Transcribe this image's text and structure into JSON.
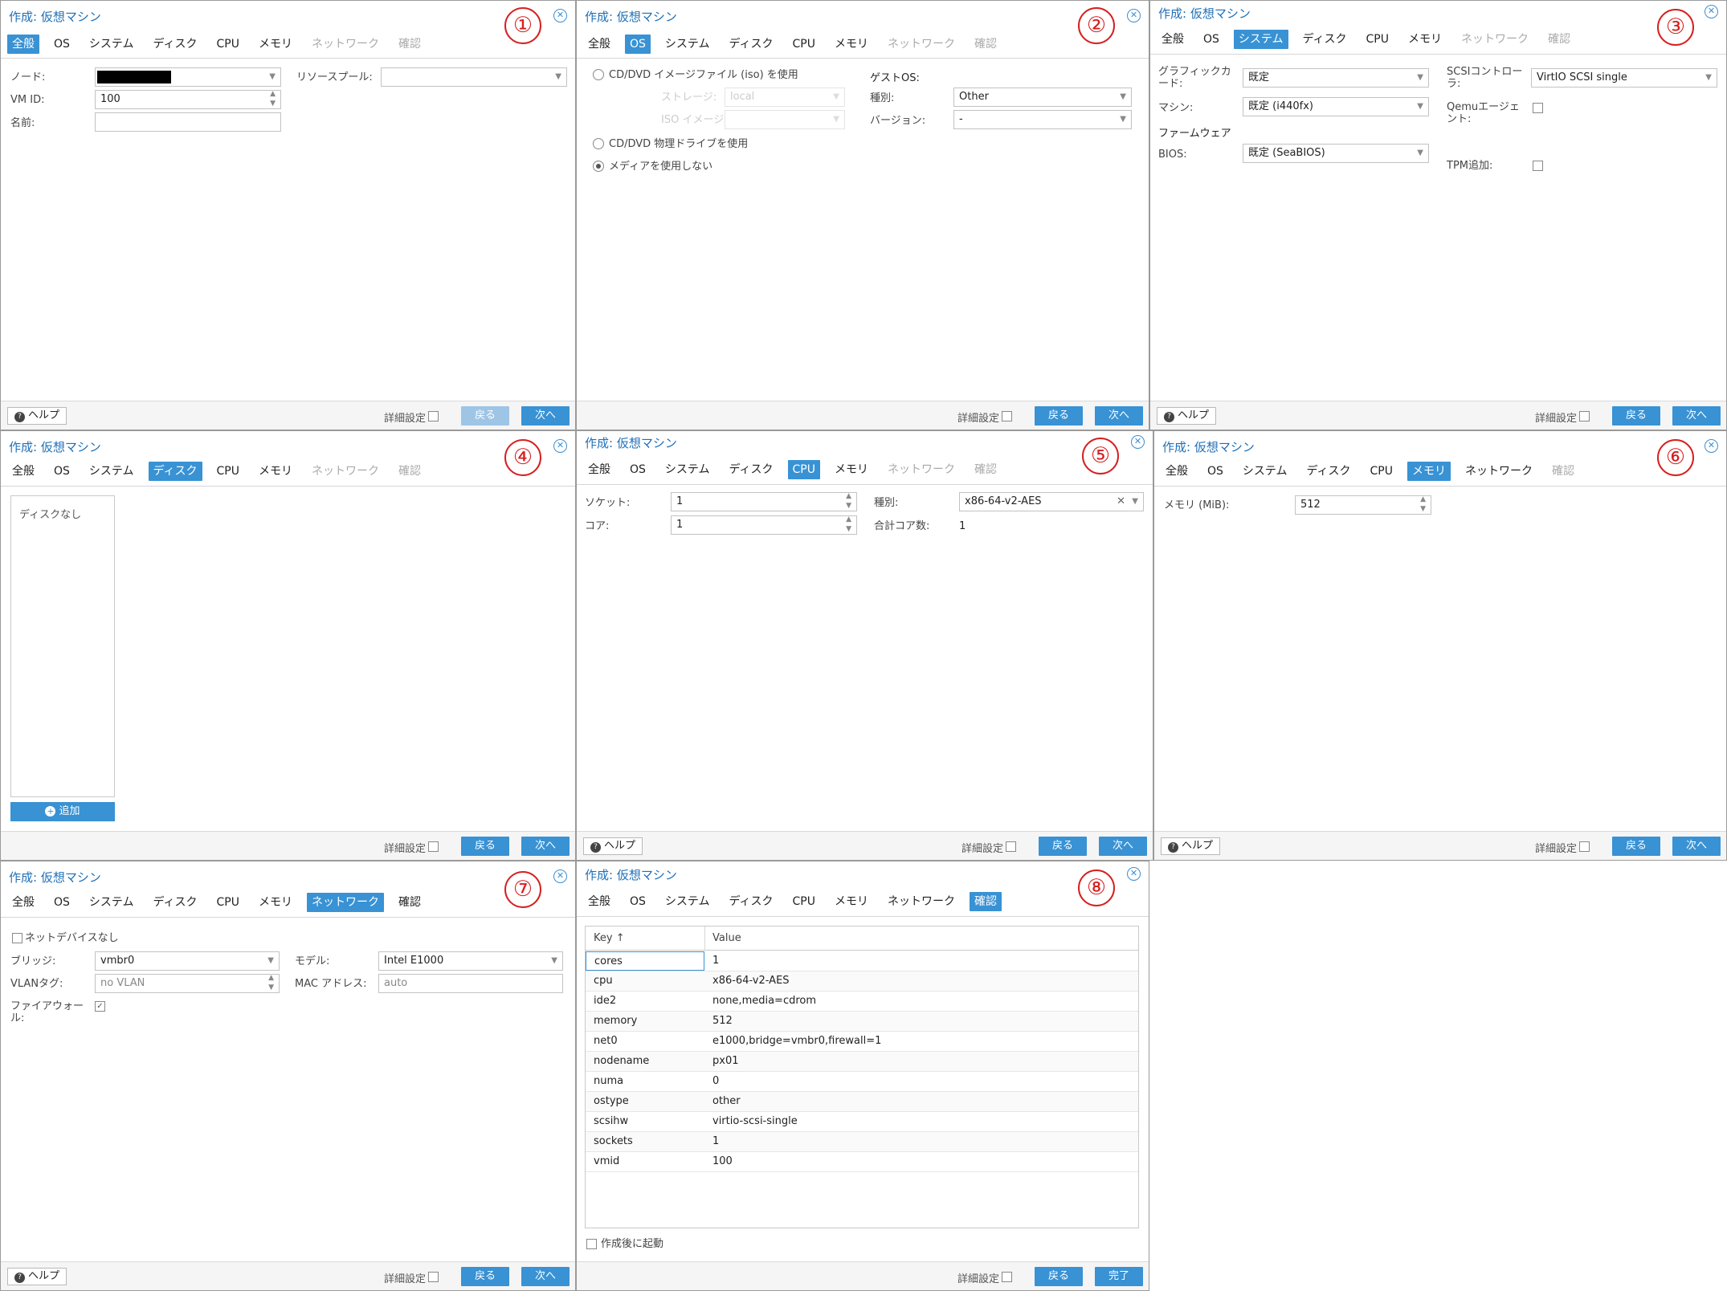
{
  "title": "作成: 仮想マシン",
  "tabs": {
    "general": "全般",
    "os": "OS",
    "system": "システム",
    "disk": "ディスク",
    "cpu": "CPU",
    "memory": "メモリ",
    "network": "ネットワーク",
    "confirm": "確認"
  },
  "footer": {
    "help": "ヘルプ",
    "advanced": "詳細設定",
    "back": "戻る",
    "next": "次へ",
    "finish": "完了"
  },
  "markers": [
    "①",
    "②",
    "③",
    "④",
    "⑤",
    "⑥",
    "⑦",
    "⑧"
  ],
  "p1": {
    "node_label": "ノード:",
    "vmid_label": "VM ID:",
    "vmid_value": "100",
    "name_label": "名前:",
    "pool_label": "リソースプール:"
  },
  "p2": {
    "iso_option": "CD/DVD イメージファイル (iso) を使用",
    "storage_label": "ストレージ:",
    "storage_value": "local",
    "iso_label": "ISO イメージ:",
    "physical_option": "CD/DVD 物理ドライブを使用",
    "none_option": "メディアを使用しない",
    "guest_os_label": "ゲストOS:",
    "type_label": "種別:",
    "type_value": "Other",
    "version_label": "バージョン:",
    "version_value": "-"
  },
  "p3": {
    "graphics_label": "グラフィックカード:",
    "graphics_value": "既定",
    "machine_label": "マシン:",
    "machine_value": "既定 (i440fx)",
    "firmware_label": "ファームウェア",
    "bios_label": "BIOS:",
    "bios_value": "既定 (SeaBIOS)",
    "scsi_label": "SCSIコントローラ:",
    "scsi_value": "VirtIO SCSI single",
    "qemu_label": "Qemuエージェント:",
    "tpm_label": "TPM追加:"
  },
  "p4": {
    "no_disk": "ディスクなし",
    "add": "追加"
  },
  "p5": {
    "socket_label": "ソケット:",
    "socket_value": "1",
    "core_label": "コア:",
    "core_value": "1",
    "type_label": "種別:",
    "type_value": "x86-64-v2-AES",
    "total_label": "合計コア数:",
    "total_value": "1"
  },
  "p6": {
    "memory_label": "メモリ (MiB):",
    "memory_value": "512"
  },
  "p7": {
    "no_net": "ネットデバイスなし",
    "bridge_label": "ブリッジ:",
    "bridge_value": "vmbr0",
    "vlan_label": "VLANタグ:",
    "vlan_placeholder": "no VLAN",
    "firewall_label": "ファイアウォール:",
    "model_label": "モデル:",
    "model_value": "Intel E1000",
    "mac_label": "MAC アドレス:",
    "mac_placeholder": "auto"
  },
  "p8": {
    "col_key": "Key ↑",
    "col_value": "Value",
    "rows": [
      {
        "key": "cores",
        "value": "1"
      },
      {
        "key": "cpu",
        "value": "x86-64-v2-AES"
      },
      {
        "key": "ide2",
        "value": "none,media=cdrom"
      },
      {
        "key": "memory",
        "value": "512"
      },
      {
        "key": "net0",
        "value": "e1000,bridge=vmbr0,firewall=1"
      },
      {
        "key": "nodename",
        "value": "px01"
      },
      {
        "key": "numa",
        "value": "0"
      },
      {
        "key": "ostype",
        "value": "other"
      },
      {
        "key": "scsihw",
        "value": "virtio-scsi-single"
      },
      {
        "key": "sockets",
        "value": "1"
      },
      {
        "key": "vmid",
        "value": "100"
      }
    ],
    "start_after": "作成後に起動"
  }
}
